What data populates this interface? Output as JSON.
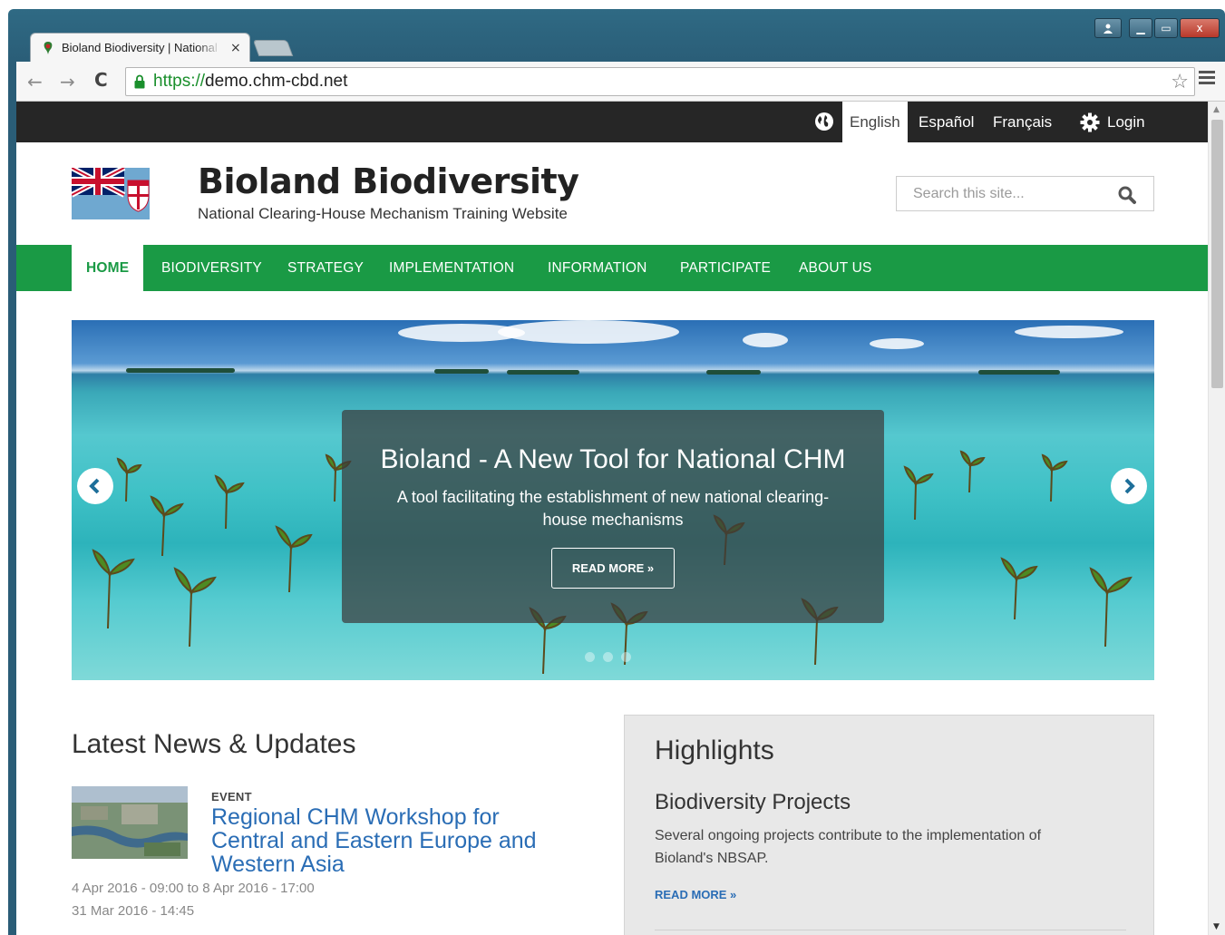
{
  "browser": {
    "tab_title": "Bioland Biodiversity | National Clearing-House Mechanism Training Website",
    "tab_close": "×",
    "back_glyph": "←",
    "forward_glyph": "→",
    "reload_glyph": "C",
    "url_scheme": "https://",
    "url_host": "demo.chm-cbd.net",
    "star_glyph": "☆",
    "window_buttons": {
      "minimize": "▁",
      "maximize": "▭",
      "close": "x"
    },
    "icons": [
      "favicon-icon",
      "lock-icon",
      "star-icon",
      "menu-icon"
    ]
  },
  "topbar": {
    "languages": [
      {
        "label": "English",
        "active": true
      },
      {
        "label": "Español",
        "active": false
      },
      {
        "label": "Français",
        "active": false
      }
    ],
    "login_label": "Login"
  },
  "header": {
    "title": "Bioland Biodiversity",
    "slogan": "National Clearing-House Mechanism Training Website",
    "search_placeholder": "Search this site..."
  },
  "nav": {
    "items": [
      {
        "label": "HOME",
        "active": true
      },
      {
        "label": "BIODIVERSITY",
        "active": false
      },
      {
        "label": "STRATEGY",
        "active": false
      },
      {
        "label": "IMPLEMENTATION",
        "active": false
      },
      {
        "label": "INFORMATION",
        "active": false
      },
      {
        "label": "PARTICIPATE",
        "active": false
      },
      {
        "label": "ABOUT US",
        "active": false
      }
    ]
  },
  "slider": {
    "title": "Bioland - A New Tool for National CHM",
    "text": "A tool facilitating the establishment of new national clearing-house mechanisms",
    "button": "READ MORE »"
  },
  "news": {
    "heading": "Latest News & Updates",
    "items": [
      {
        "type": "EVENT",
        "title": "Regional CHM Workshop for Central and Eastern Europe and Western Asia",
        "dates": "4 Apr 2016 - 09:00 to 8 Apr 2016 - 17:00",
        "posted": "31 Mar 2016 - 14:45"
      }
    ]
  },
  "highlights": {
    "heading": "Highlights",
    "subheading": "Biodiversity Projects",
    "text": "Several ongoing projects contribute to the implementation of Bioland's NBSAP.",
    "link": "READ MORE »"
  },
  "colors": {
    "brand_green": "#1a9a45",
    "topbar_bg": "#262626",
    "link_blue": "#2a6db5",
    "url_green": "#1a8f2c"
  }
}
